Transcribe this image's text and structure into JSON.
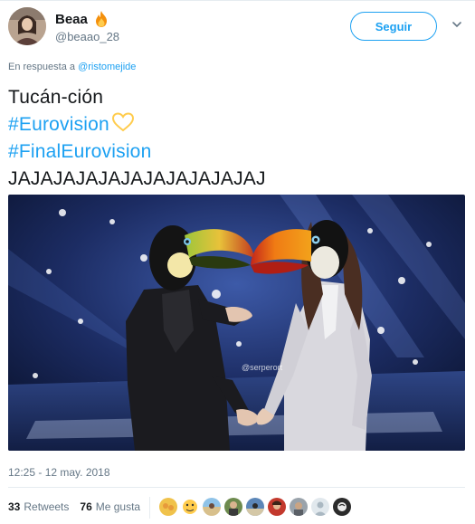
{
  "user": {
    "display_name": "Beaa",
    "handle": "@beaao_28",
    "name_emoji": "fire-icon"
  },
  "actions": {
    "follow_label": "Seguir",
    "menu_icon": "chevron-down-icon"
  },
  "reply_context": {
    "prefix": "En respuesta a",
    "mention": "@ristomejide"
  },
  "tweet": {
    "line1": "Tucán-ción",
    "hashtag1": "#Eurovision",
    "hashtag2": "#FinalEurovision",
    "line4": "JAJAJAJAJAJAJAJAJAJAJAJ",
    "heart_icon": "yellow-heart-icon",
    "photo_watermark": "@serperort"
  },
  "meta": {
    "timestamp": "12:25 - 12 may. 2018"
  },
  "stats": {
    "retweets_count": "33",
    "retweets_label": "Retweets",
    "likes_count": "76",
    "likes_label": "Me gusta"
  },
  "colors": {
    "accent": "#1da1f2",
    "secondary_text": "#657786",
    "heart": "#ffcc4d"
  }
}
